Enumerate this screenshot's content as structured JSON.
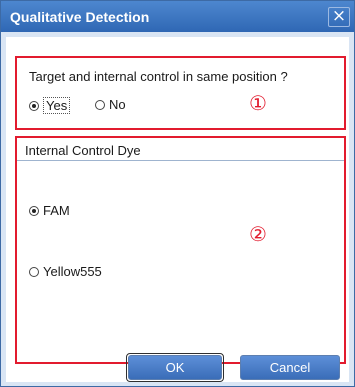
{
  "dialog": {
    "title": "Qualitative Detection",
    "close_glyph": "×"
  },
  "section1": {
    "question": "Target and internal control in same position ?",
    "options": [
      {
        "label": "Yes",
        "checked": true
      },
      {
        "label": "No",
        "checked": false
      }
    ],
    "marker": "①"
  },
  "section2": {
    "title": "Internal Control Dye",
    "options": [
      {
        "label": "FAM",
        "checked": true
      },
      {
        "label": "Yellow555",
        "checked": false
      }
    ],
    "marker": "②"
  },
  "buttons": {
    "ok": "OK",
    "cancel": "Cancel"
  },
  "colors": {
    "highlight_box": "#e21b2e",
    "title_bar": "#2f67b4",
    "button": "#3a6db8"
  },
  "icons": {
    "close": "close-icon",
    "radio_checked": "radio-checked-icon",
    "radio_unchecked": "radio-unchecked-icon"
  }
}
